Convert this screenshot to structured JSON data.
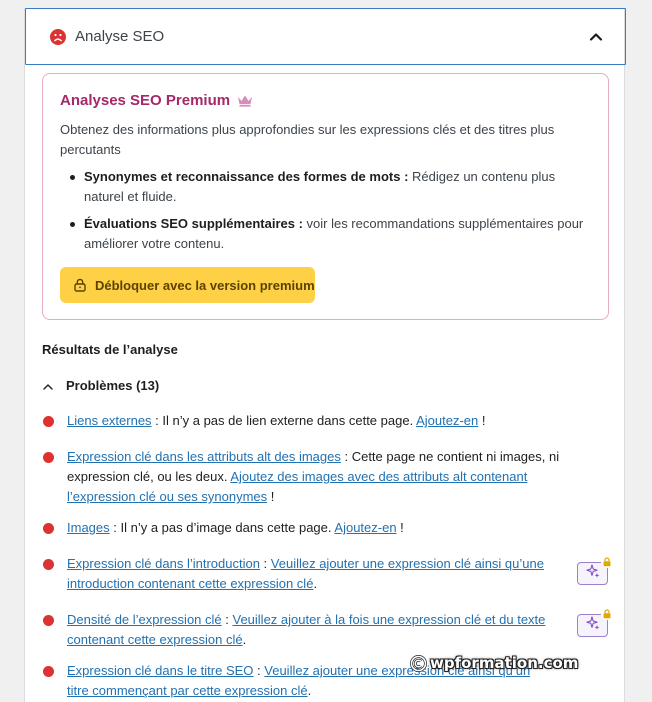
{
  "panel": {
    "title": "Analyse SEO"
  },
  "premium": {
    "title": "Analyses SEO Premium",
    "description": "Obtenez des informations plus approfondies sur les expressions clés et des titres plus percutants",
    "features": [
      {
        "title": "Synonymes et reconnaissance des formes de mots :",
        "text": " Rédigez un contenu plus naturel et fluide."
      },
      {
        "title": "Évaluations SEO supplémentaires :",
        "text": " voir les recommandations supplémentaires pour améliorer votre contenu."
      }
    ],
    "unlock_label": "Débloquer avec la version premium"
  },
  "results": {
    "title": "Résultats de l’analyse",
    "problems_label": "Problèmes (13)",
    "items": [
      {
        "link": "Liens externes",
        "text": " : Il n’y a pas de lien externe dans cette page. ",
        "action": "Ajoutez-en",
        "tail": " !"
      },
      {
        "link": "Expression clé dans les attributs alt des images",
        "text": " : Cette page ne contient ni images, ni expression clé, ou les deux. ",
        "action": "Ajoutez des images avec des attributs alt contenant l’expression clé ou ses synonymes",
        "tail": " !"
      },
      {
        "link": "Images",
        "text": " : Il n’y a pas d’image dans cette page. ",
        "action": "Ajoutez-en",
        "tail": " !"
      },
      {
        "link": "Expression clé dans l’introduction",
        "text": " : ",
        "action": "Veuillez ajouter une expression clé ainsi qu’une introduction contenant cette expression clé",
        "tail": "."
      },
      {
        "link": "Densité de l’expression clé",
        "text": " : ",
        "action": "Veuillez ajouter à la fois une expression clé et du texte contenant cette expression clé",
        "tail": "."
      },
      {
        "link": "Expression clé dans le titre SEO",
        "text": " : ",
        "action": "Veuillez ajouter une expression clé ainsi qu’un titre commençant par cette expression clé",
        "tail": "."
      }
    ]
  },
  "watermark": {
    "text": "wpformation.com"
  },
  "colors": {
    "brand_pink": "#a4286a",
    "premium_yellow": "#fed046",
    "problem_red": "#dc3232",
    "link_blue": "#2271b1",
    "header_border": "#3b7cc4"
  }
}
